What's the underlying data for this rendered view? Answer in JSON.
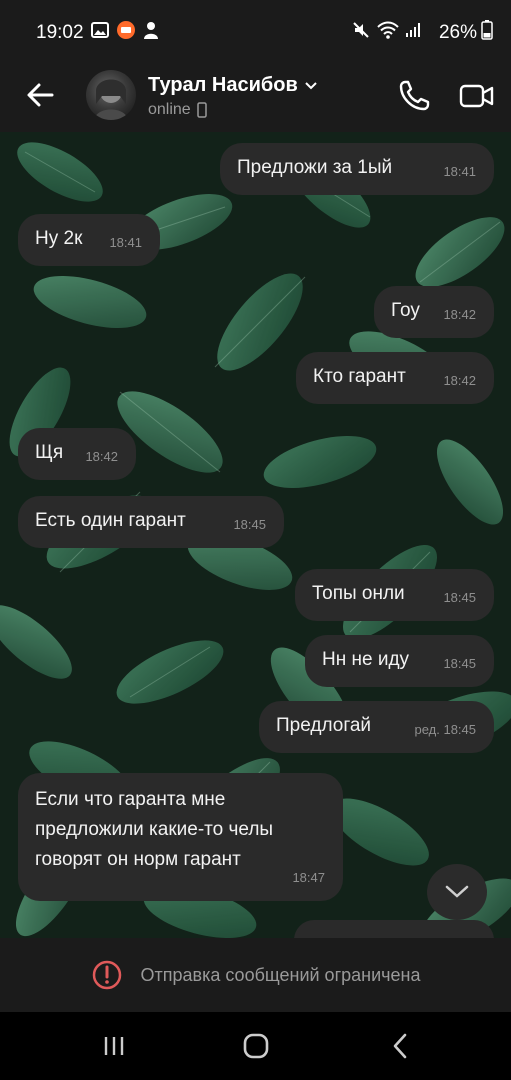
{
  "status_bar": {
    "time": "19:02",
    "battery": "26%"
  },
  "header": {
    "contact_name": "Турал Насибов",
    "contact_status": "online"
  },
  "messages": [
    {
      "direction": "out",
      "text": "Предложи за 1ый",
      "time": "18:41"
    },
    {
      "direction": "in",
      "text": "Ну 2к",
      "time": "18:41"
    },
    {
      "direction": "out",
      "text": "Гоу",
      "time": "18:42"
    },
    {
      "direction": "out",
      "text": "Кто гарант",
      "time": "18:42"
    },
    {
      "direction": "in",
      "text": "Щя",
      "time": "18:42"
    },
    {
      "direction": "in",
      "text": "Есть один гарант",
      "time": "18:45"
    },
    {
      "direction": "out",
      "text": "Топы онли",
      "time": "18:45"
    },
    {
      "direction": "out",
      "text": "Нн не иду",
      "time": "18:45"
    },
    {
      "direction": "out",
      "text": "Предлогай",
      "time": "ред. 18:45"
    },
    {
      "direction": "in",
      "text": "Если что гаранта мне предложили какие-то челы говорят он норм гарант",
      "lines": [
        "Если что гаранта мне",
        "предложили какие-то челы",
        "говорят он норм гарант"
      ],
      "time": "18:47"
    }
  ],
  "restriction": {
    "text": "Отправка сообщений ограничена",
    "icon": "alert-circle-icon",
    "icon_color": "#e05a5a"
  },
  "colors": {
    "bubble": "#2a2a2a",
    "bars": "#1b1b1b"
  }
}
